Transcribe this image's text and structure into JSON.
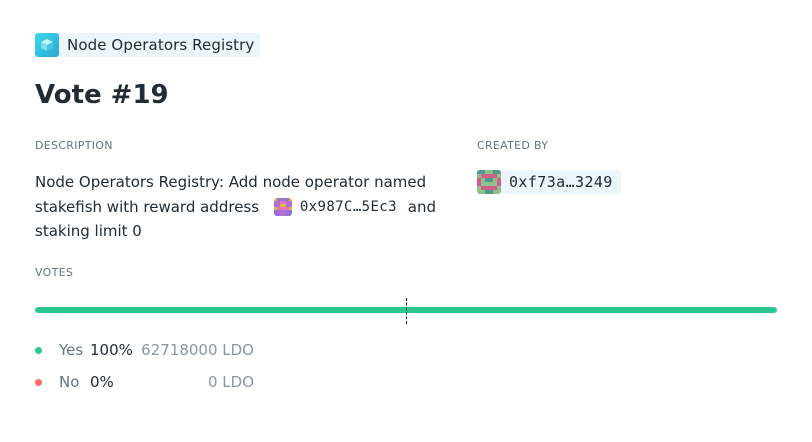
{
  "app": {
    "name": "Node Operators Registry",
    "icon": "cube-icon"
  },
  "vote": {
    "title": "Vote #19"
  },
  "description": {
    "label": "DESCRIPTION",
    "line1": "Node Operators Registry: Add node operator named",
    "line2_before": "stakefish with reward address",
    "reward_address": "0x987C…5Ec3",
    "line2_after": "and",
    "line3": "staking limit 0"
  },
  "created_by": {
    "label": "CREATED BY",
    "address": "0xf73a…3249"
  },
  "votes": {
    "label": "VOTES",
    "yes_fraction": 1.0,
    "quorum_fraction": 0.5,
    "colors": {
      "yes": "#2cc68f",
      "no": "#ff6969",
      "track": "#e6e9ed"
    },
    "rows": [
      {
        "option": "Yes",
        "percent": "100%",
        "amount": "62718000 LDO"
      },
      {
        "option": "No",
        "percent": "0%",
        "amount": "0 LDO"
      }
    ]
  }
}
